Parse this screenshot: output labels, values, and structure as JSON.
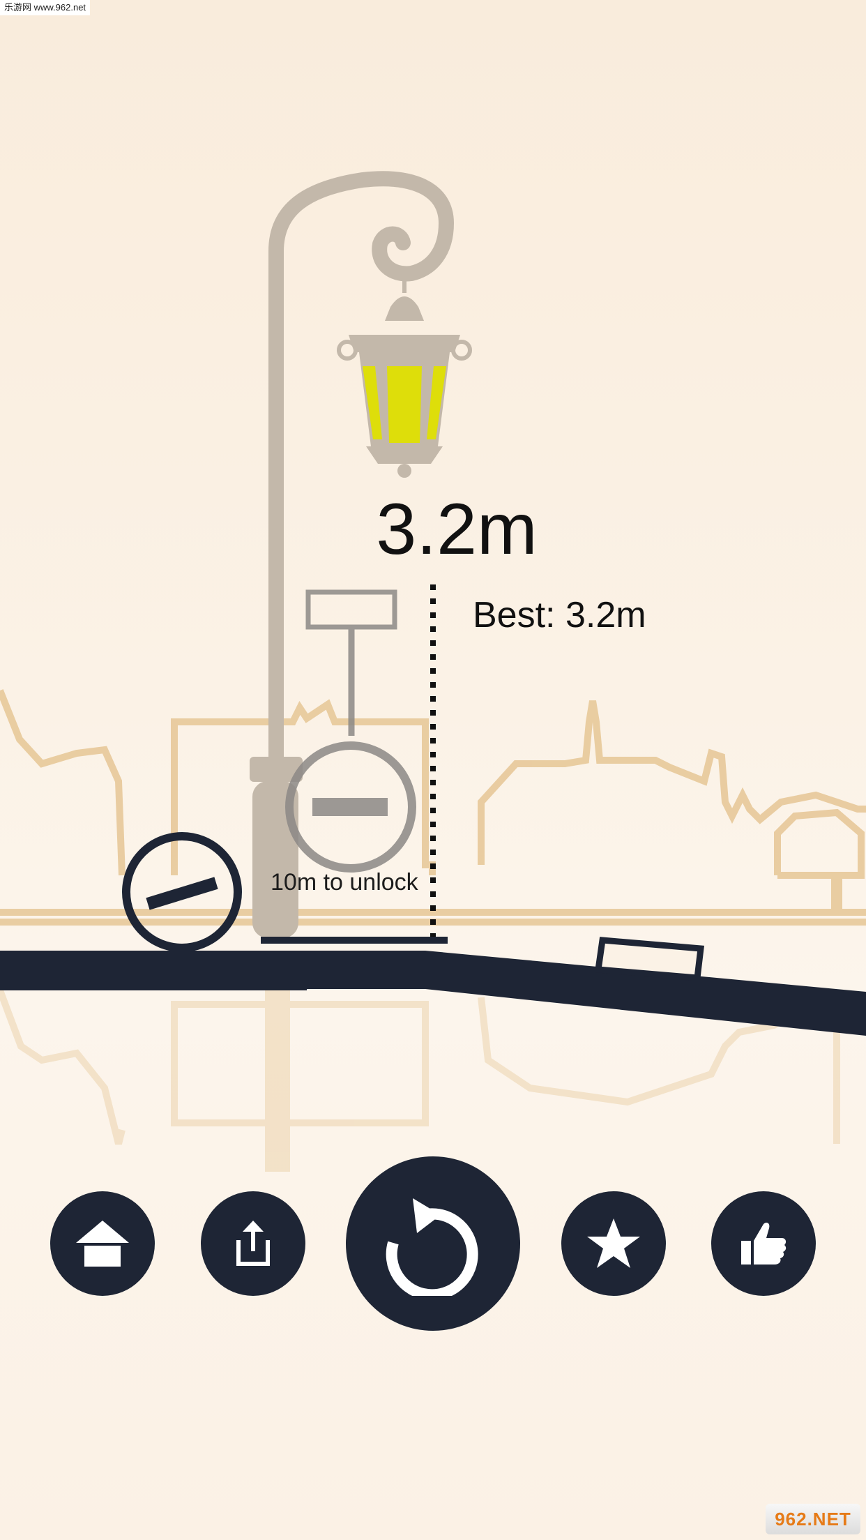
{
  "watermark": {
    "site": "乐游网 www.962.net"
  },
  "hud": {
    "distance": "3.2m",
    "best": "Best: 3.2m",
    "unlock_hint": "10m to unlock"
  },
  "buttons": {
    "home": "home-icon",
    "share": "share-icon",
    "restart": "restart-icon",
    "rate": "star-icon",
    "like": "thumbs-up-icon"
  },
  "logo": {
    "text": "962.NET"
  },
  "colors": {
    "background": "#fbf2e6",
    "ground": "#1e2535",
    "lamp_glow": "#dede0a",
    "skyline": "#e3c08a"
  }
}
